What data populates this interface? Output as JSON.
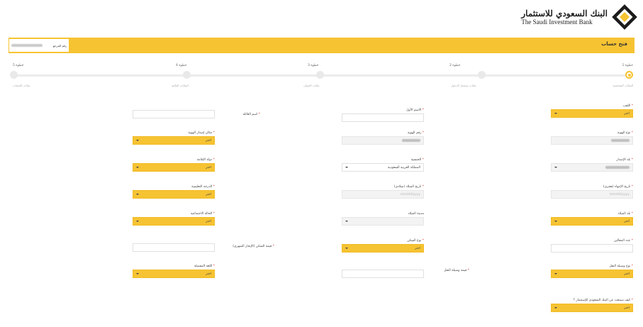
{
  "logo": {
    "arabic": "البنك السعودي للاستثمار",
    "english": "The Saudi Investment Bank"
  },
  "header": {
    "title": "فتح حساب",
    "ref_label": "رقم المرجع"
  },
  "steps": [
    {
      "num": "خطوة 1",
      "label": "البيانات الشخصية"
    },
    {
      "num": "خطوة 2",
      "label": "بيانات تسجيل الدخول"
    },
    {
      "num": "خطوة 3",
      "label": "بيانات العنوان"
    },
    {
      "num": "خطوة 4",
      "label": "البيانات المالية"
    },
    {
      "num": "خطوة 5",
      "label": "بيانات الحساب"
    }
  ],
  "fields": {
    "title": {
      "label": "اللقب",
      "value": "اختر"
    },
    "id_type": {
      "label": "نوع الهوية",
      "value": ""
    },
    "issue_country": {
      "label": "بلد الإصدار",
      "value": ""
    },
    "expiry_hijri": {
      "label": "تاريخ الإنتهاء (هجري)",
      "placeholder": "mm/dd/yyyy"
    },
    "birth_country": {
      "label": "بلد الميلاد",
      "value": "اختر"
    },
    "dependents": {
      "label": "عدد المعالين",
      "value": ""
    },
    "transport": {
      "label": "نوع وسيلة النقل",
      "value": "اختر"
    },
    "heard_about": {
      "label": "كيف سمعت عن البنك السعودي للإستثمار ؟",
      "value": "اختر"
    },
    "first_name": {
      "label": "الاسم الأول",
      "value": ""
    },
    "id_number": {
      "label": "رقم الهوية",
      "value": ""
    },
    "nationality": {
      "label": "الجنسية",
      "value": "المملكة العربية السعودية"
    },
    "birth_date": {
      "label": "تاريخ الميلاد (ميلادي)",
      "placeholder": "mm/dd/yyyy"
    },
    "birth_city": {
      "label": "مدينة الميلاد",
      "value": ""
    },
    "residence_type": {
      "label": "نوع السكن",
      "value": "اختر"
    },
    "transport_value": {
      "label": "قيمة وسيلة النقل",
      "value": ""
    },
    "family_name": {
      "label": "اسم العائلة",
      "value": ""
    },
    "id_issue_place": {
      "label": "مكان إصدار الهوية",
      "value": "اختر"
    },
    "residence_country": {
      "label": "دولة الإقامة",
      "value": "اختر"
    },
    "education": {
      "label": "الدرجة التعليمية",
      "value": "اختر"
    },
    "marital": {
      "label": "الحالة الاجتماعية",
      "value": "اختر"
    },
    "rent_value": {
      "label": "قيمة السكن (الإيجار الشهري)",
      "value": ""
    },
    "language": {
      "label": "اللغة المفضلة",
      "value": "اختر"
    }
  },
  "colors": {
    "accent": "#f6c332",
    "logo_dark": "#1c1c1c"
  },
  "icons": {
    "dropdown": "chevron-down-icon",
    "logo": "sib-diamond-logo"
  }
}
